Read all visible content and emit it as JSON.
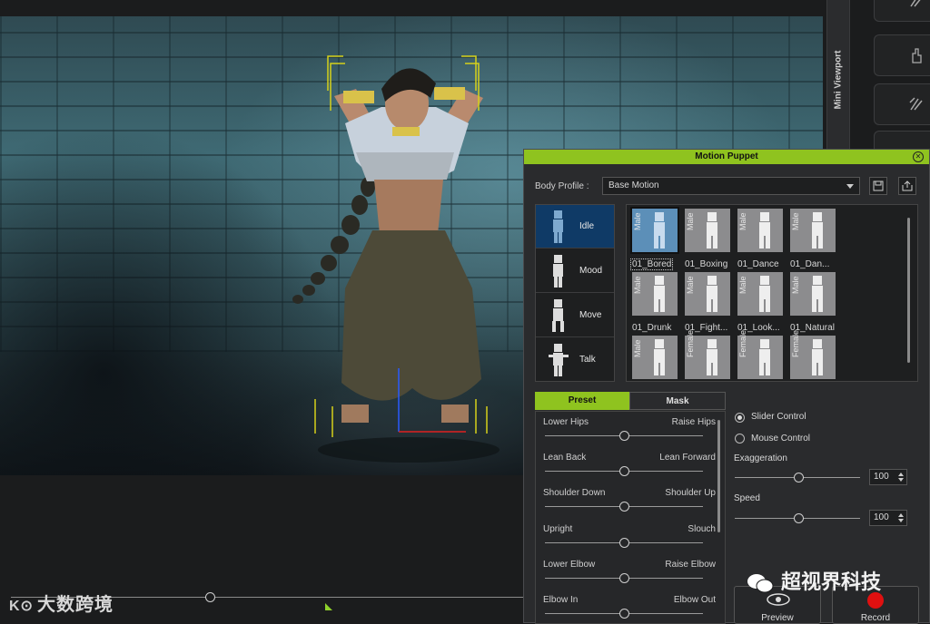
{
  "side_tab": {
    "label": "Mini Viewport"
  },
  "panel": {
    "title": "Motion Puppet",
    "body_profile_label": "Body Profile :",
    "body_profile_value": "Base Motion",
    "categories": [
      "Idle",
      "Mood",
      "Move",
      "Talk"
    ],
    "thumbnails": [
      {
        "tag": "Male",
        "name": "01_Bored"
      },
      {
        "tag": "Male",
        "name": "01_Boxing"
      },
      {
        "tag": "Male",
        "name": "01_Dance"
      },
      {
        "tag": "Male",
        "name": "01_Dan..."
      },
      {
        "tag": "Male",
        "name": "01_Drunk"
      },
      {
        "tag": "Male",
        "name": "01_Fight..."
      },
      {
        "tag": "Male",
        "name": "01_Look..."
      },
      {
        "tag": "Male",
        "name": "01_Natural"
      },
      {
        "tag": "Male",
        "name": ""
      },
      {
        "tag": "Female",
        "name": ""
      },
      {
        "tag": "Female",
        "name": ""
      },
      {
        "tag": "Female",
        "name": ""
      }
    ],
    "tabs": {
      "preset": "Preset",
      "mask": "Mask"
    },
    "sliders": [
      {
        "left": "Lower Hips",
        "right": "Raise Hips",
        "value": 0.5
      },
      {
        "left": "Lean Back",
        "right": "Lean Forward",
        "value": 0.5
      },
      {
        "left": "Shoulder Down",
        "right": "Shoulder Up",
        "value": 0.5
      },
      {
        "left": "Upright",
        "right": "Slouch",
        "value": 0.5
      },
      {
        "left": "Lower Elbow",
        "right": "Raise Elbow",
        "value": 0.5
      },
      {
        "left": "Elbow In",
        "right": "Elbow Out",
        "value": 0.5
      }
    ],
    "control": {
      "slider_control": "Slider Control",
      "mouse_control": "Mouse Control",
      "exaggeration_label": "Exaggeration",
      "exaggeration_value": "100",
      "speed_label": "Speed",
      "speed_value": "100",
      "preview_label": "Preview",
      "record_label": "Record"
    }
  },
  "watermarks": {
    "left": "大数跨境",
    "right": "超视界科技"
  },
  "colors": {
    "accent": "#8fc31f",
    "selected": "#0f3a66",
    "record": "#e01010"
  }
}
